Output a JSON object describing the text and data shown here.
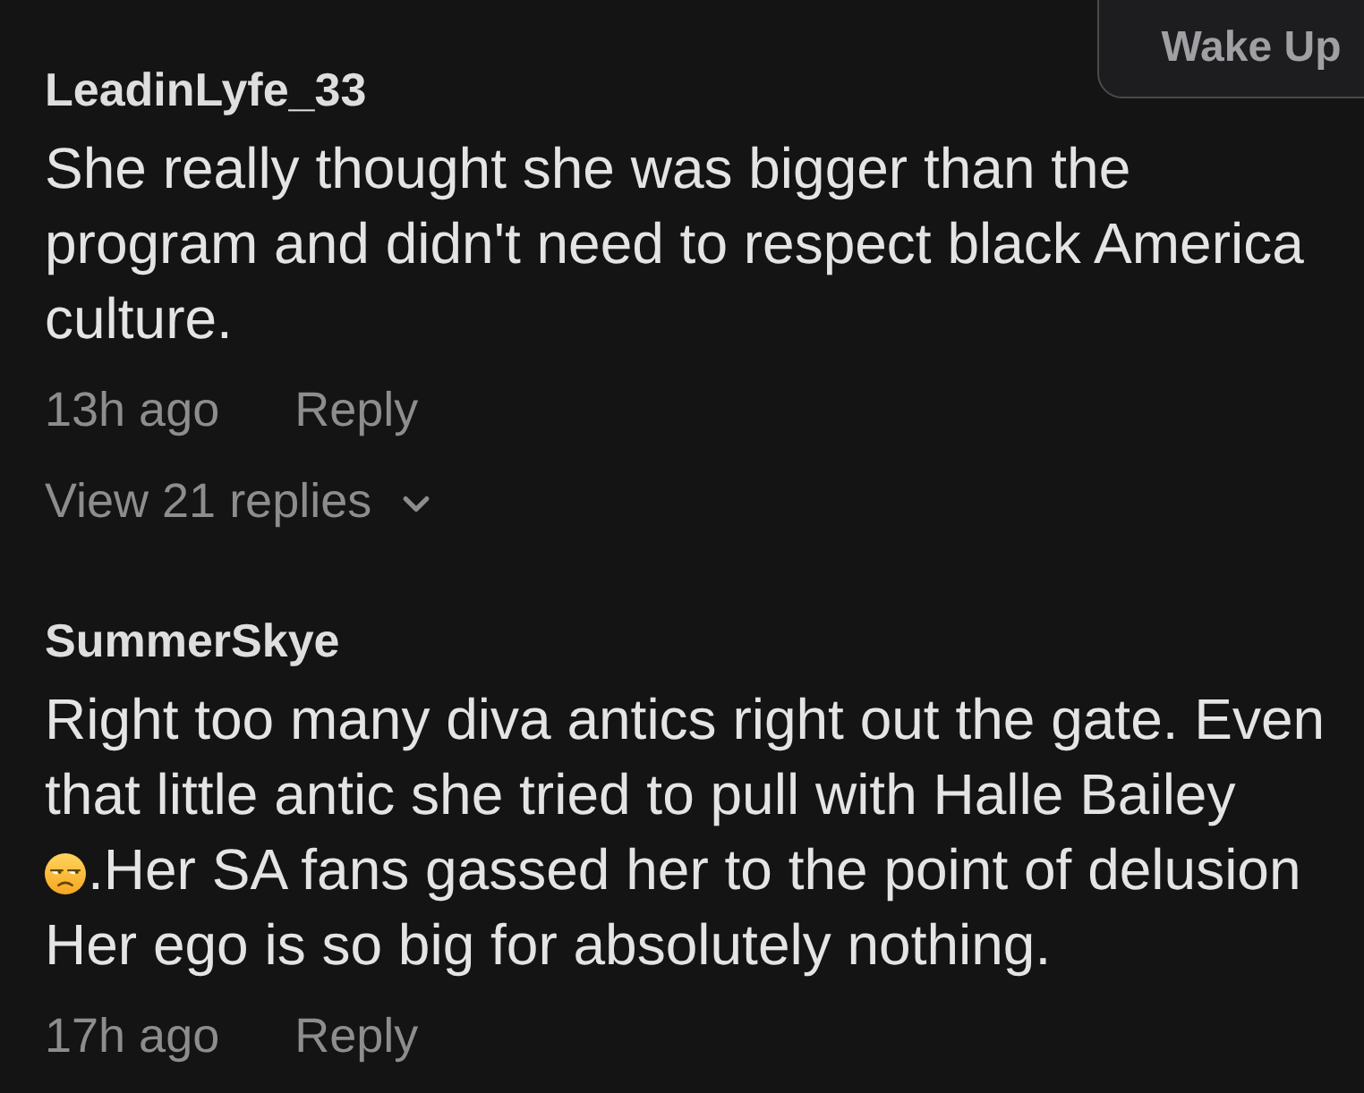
{
  "wake_up_button": {
    "label": "Wake Up"
  },
  "comments": [
    {
      "username": "LeadinLyfe_33",
      "body": [
        [
          {
            "kind": "text",
            "text": "She really thought she was bigger than the\nprogram and didn't need to respect black America\nculture."
          }
        ]
      ],
      "time": "13h ago",
      "reply": "Reply",
      "view_replies": "View 21 replies"
    },
    {
      "username": "SummerSkye",
      "body": [
        [
          {
            "kind": "text",
            "text": "Right too many diva antics right out the gate. Even\nthat little antic she tried to pull with Halle Bailey"
          }
        ],
        [
          {
            "kind": "emoji"
          },
          {
            "kind": "text",
            "text": ".Her SA fans gassed her to the point of delusion"
          }
        ],
        [
          {
            "kind": "text",
            "text": "Her ego is so big for absolutely nothing."
          }
        ]
      ],
      "time": "17h ago",
      "reply": "Reply"
    }
  ]
}
